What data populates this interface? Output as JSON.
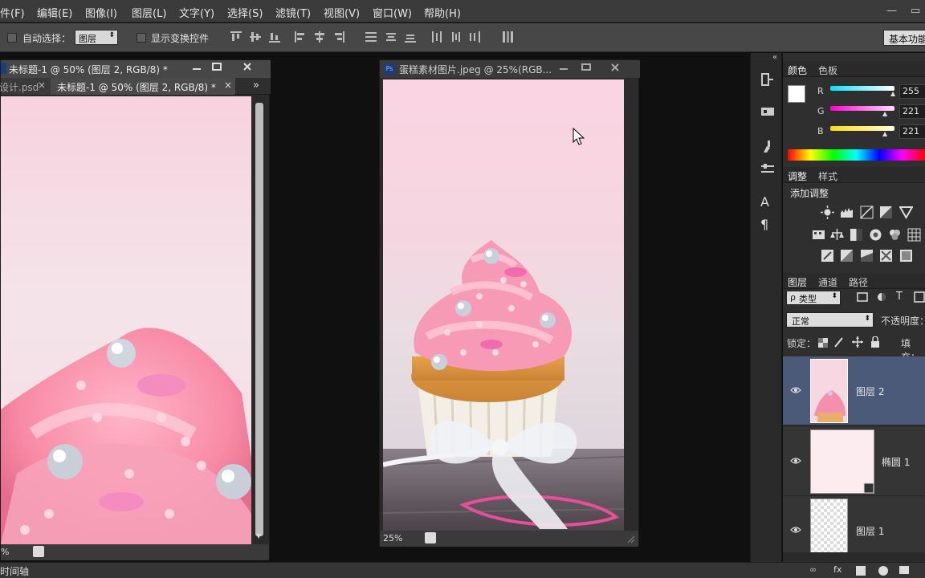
{
  "menu": {
    "items": [
      "件(F)",
      "编辑(E)",
      "图像(I)",
      "图层(L)",
      "文字(Y)",
      "选择(S)",
      "滤镜(T)",
      "视图(V)",
      "窗口(W)",
      "帮助(H)"
    ]
  },
  "window_controls": {
    "minimize": "—",
    "restore": "▭"
  },
  "options": {
    "auto_select_label": "自动选择：",
    "auto_select_target": "图层",
    "show_transform_label": "显示变换控件",
    "workspace": "基本功能"
  },
  "doc_left": {
    "tab_label": "未标题-1 @ 50% (图层 2, RGB/8) *",
    "tab2_label": "设计.psd",
    "tab3_label": "未标题-1 @ 50% (图层 2, RGB/8) *",
    "tab_close": "×",
    "overflow": "»",
    "zoom": "%"
  },
  "doc_center": {
    "ps_badge": "Ps",
    "title": "蛋糕素材图片.jpeg @ 25%(RGB...",
    "zoom": "25%"
  },
  "panel": {
    "collapse": "«",
    "color_tabs": [
      "颜色",
      "色板"
    ],
    "rgb": {
      "r_label": "R",
      "r_value": "255",
      "g_label": "G",
      "g_value": "221",
      "b_label": "B",
      "b_value": "221"
    },
    "adjust_tabs": [
      "调整",
      "样式"
    ],
    "add_adjustment": "添加调整",
    "layer_tabs": [
      "图层",
      "通道",
      "路径"
    ],
    "filter_type": "类型",
    "filter_prefix": "ρ",
    "blend_mode": "正常",
    "opacity_label": "不透明度：",
    "lock_label": "锁定：",
    "fill_label": "填充：",
    "layers": [
      {
        "name": "图层 2"
      },
      {
        "name": "椭圆 1"
      },
      {
        "name": "图层 1"
      }
    ],
    "text_tool_icon": "A",
    "paragraph_icon": "¶"
  },
  "bottom": {
    "timeline": "时间轴"
  },
  "colors": {
    "selected_layer": "#4a5a78",
    "foreground": "#ffffff",
    "background": "#dff4fb"
  }
}
